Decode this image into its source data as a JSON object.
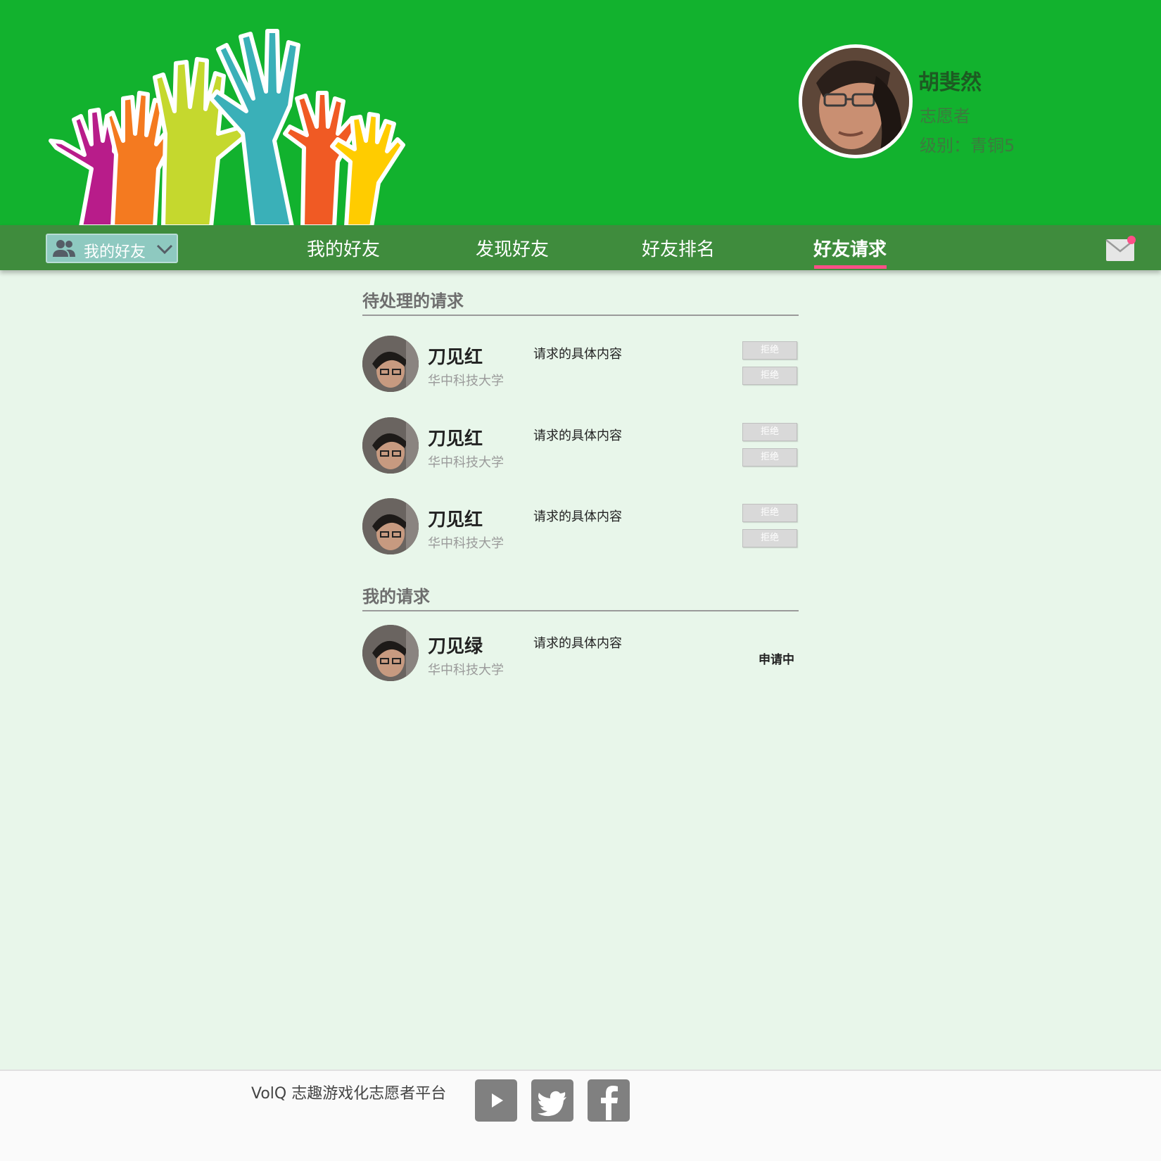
{
  "profile": {
    "name": "胡斐然",
    "role": "志愿者",
    "level": "级别：青铜5"
  },
  "nav": {
    "dropdown_label": "我的好友",
    "items": [
      {
        "label": "我的好友"
      },
      {
        "label": "发现好友"
      },
      {
        "label": "好友排名"
      },
      {
        "label": "好友请求"
      }
    ],
    "active": "好友请求"
  },
  "pending": {
    "title": "待处理的请求",
    "requests": [
      {
        "name": "刀见红",
        "school": "华中科技大学",
        "content": "请求的具体内容",
        "btn1": "拒绝",
        "btn2": "拒绝"
      },
      {
        "name": "刀见红",
        "school": "华中科技大学",
        "content": "请求的具体内容",
        "btn1": "拒绝",
        "btn2": "拒绝"
      },
      {
        "name": "刀见红",
        "school": "华中科技大学",
        "content": "请求的具体内容",
        "btn1": "拒绝",
        "btn2": "拒绝"
      }
    ]
  },
  "mine": {
    "title": "我的请求",
    "requests": [
      {
        "name": "刀见绿",
        "school": "华中科技大学",
        "content": "请求的具体内容",
        "status": "申请中"
      }
    ]
  },
  "footer": {
    "text": "VolQ 志趣游戏化志愿者平台",
    "social": [
      "youtube-icon",
      "twitter-icon",
      "facebook-icon"
    ]
  },
  "colors": {
    "header_bg": "#12b22e",
    "nav_bg": "#3f8c3d",
    "active_underline": "#ff4f87",
    "page_bg": "#e8f6ea"
  }
}
